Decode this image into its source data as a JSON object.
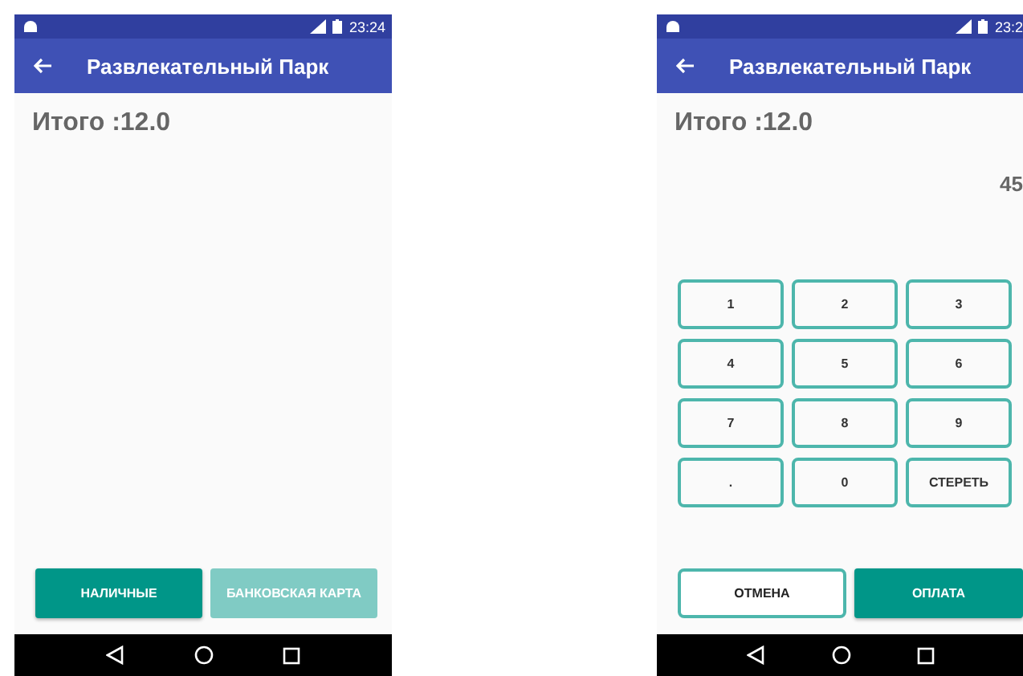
{
  "screens": [
    {
      "status_bar": {
        "time": "23:24"
      },
      "app_bar": {
        "title": "Развлекательный Парк"
      },
      "total": "Итого :12.0",
      "buttons": [
        {
          "label": "НАЛИЧНЫЕ",
          "kind": "filled",
          "disabled": false
        },
        {
          "label": "БАНКОВСКАЯ КАРТА",
          "kind": "filled",
          "disabled": true
        }
      ]
    },
    {
      "status_bar": {
        "time": "23:2"
      },
      "app_bar": {
        "title": "Развлекательный Парк"
      },
      "total": "Итого :12.0",
      "entry": "45",
      "keypad": [
        "1",
        "2",
        "3",
        "4",
        "5",
        "6",
        "7",
        "8",
        "9",
        ".",
        "0",
        "СТЕРЕТЬ"
      ],
      "buttons": [
        {
          "label": "ОТМЕНА",
          "kind": "outlined",
          "disabled": false
        },
        {
          "label": "ОПЛАТА",
          "kind": "filled",
          "disabled": false
        }
      ]
    }
  ]
}
